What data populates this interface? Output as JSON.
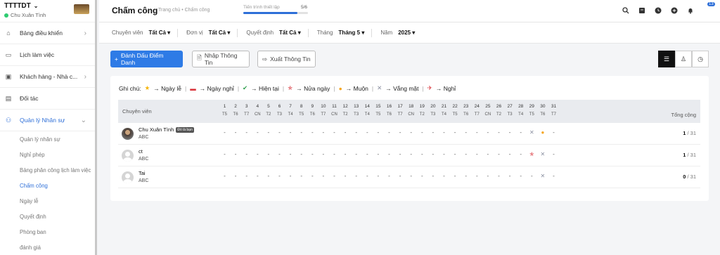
{
  "sidebar": {
    "org": "TTTTDT",
    "user": "Chu Xuân Tình",
    "nav": [
      {
        "label": "Bảng điều khiển",
        "icon": "home-icon",
        "glyph": "⌂",
        "chev": "›"
      },
      {
        "label": "Lịch làm việc",
        "icon": "calendar-icon",
        "glyph": "▭",
        "chev": ""
      },
      {
        "label": "Khách hàng - Nhà c...",
        "icon": "customer-icon",
        "glyph": "▣",
        "chev": "›"
      },
      {
        "label": "Đối tác",
        "icon": "partner-icon",
        "glyph": "▤",
        "chev": ""
      },
      {
        "label": "Quản lý Nhân sự",
        "icon": "users-icon",
        "glyph": "⚇",
        "chev": "⌄"
      }
    ],
    "sub": [
      "Quản lý nhân sự",
      "Nghỉ phép",
      "Bảng phân công lịch làm việc",
      "Chấm công",
      "Ngày lễ",
      "Quyết định",
      "Phòng ban",
      "đánh giá"
    ]
  },
  "header": {
    "title": "Chấm công",
    "breadcrumb": "Trang chủ • Chấm công",
    "progress_label": "Tiến trình thiết lập",
    "progress_count": "5/6",
    "progress_fraction": 0.8333,
    "notif_count": "13"
  },
  "filters": [
    {
      "label": "Chuyên viên",
      "value": "Tất Cả ▾"
    },
    {
      "label": "Đơn vị",
      "value": "Tất Cả ▾"
    },
    {
      "label": "Quyết định",
      "value": "Tất Cả ▾"
    },
    {
      "label": "Tháng",
      "value": "Tháng 5 ▾"
    },
    {
      "label": "Năm",
      "value": "2025 ▾"
    }
  ],
  "actions": {
    "mark": "Đánh Dấu Điểm Danh",
    "import": "Nhập Thông Tin",
    "export": "Xuất Thông Tin"
  },
  "legend": {
    "title": "Ghi chú:",
    "items": [
      "→ Ngày lễ",
      "→ Ngày nghỉ",
      "→ Hiện tại",
      "→ Nửa ngày",
      "→ Muộn",
      "→ Vắng mặt",
      "→ Nghỉ"
    ]
  },
  "table": {
    "col_name": "Chuyên viên",
    "col_total": "Tổng cộng",
    "days": [
      "1",
      "2",
      "3",
      "4",
      "5",
      "6",
      "7",
      "8",
      "9",
      "10",
      "11",
      "12",
      "13",
      "14",
      "15",
      "16",
      "17",
      "18",
      "19",
      "20",
      "21",
      "22",
      "23",
      "24",
      "25",
      "26",
      "27",
      "28",
      "29",
      "30",
      "31"
    ],
    "weekdays": [
      "T5",
      "T6",
      "T7",
      "CN",
      "T2",
      "T3",
      "T4",
      "T5",
      "T6",
      "T7",
      "CN",
      "T2",
      "T3",
      "T4",
      "T5",
      "T6",
      "T7",
      "CN",
      "T2",
      "T3",
      "T4",
      "T5",
      "T6",
      "T7",
      "CN",
      "T2",
      "T3",
      "T4",
      "T5",
      "T6",
      "T7"
    ],
    "rows": [
      {
        "name": "Chu Xuân Tình",
        "tag": "Đó là bạn",
        "dept": "ABC",
        "total_num": "1",
        "total_den": " / 31",
        "marks": {
          "29": "x",
          "30": "late"
        }
      },
      {
        "name": "ct",
        "tag": "",
        "dept": "ABC",
        "total_num": "1",
        "total_den": " / 31",
        "marks": {
          "29": "half",
          "30": "x"
        }
      },
      {
        "name": "Tai",
        "tag": "",
        "dept": "ABC",
        "total_num": "0",
        "total_den": " / 31",
        "marks": {
          "30": "x"
        }
      }
    ]
  },
  "colors": {
    "accent": "#2e7be6",
    "holiday": "#f5b400",
    "absent": "#8a8fa0",
    "present": "#2e9e4d"
  }
}
